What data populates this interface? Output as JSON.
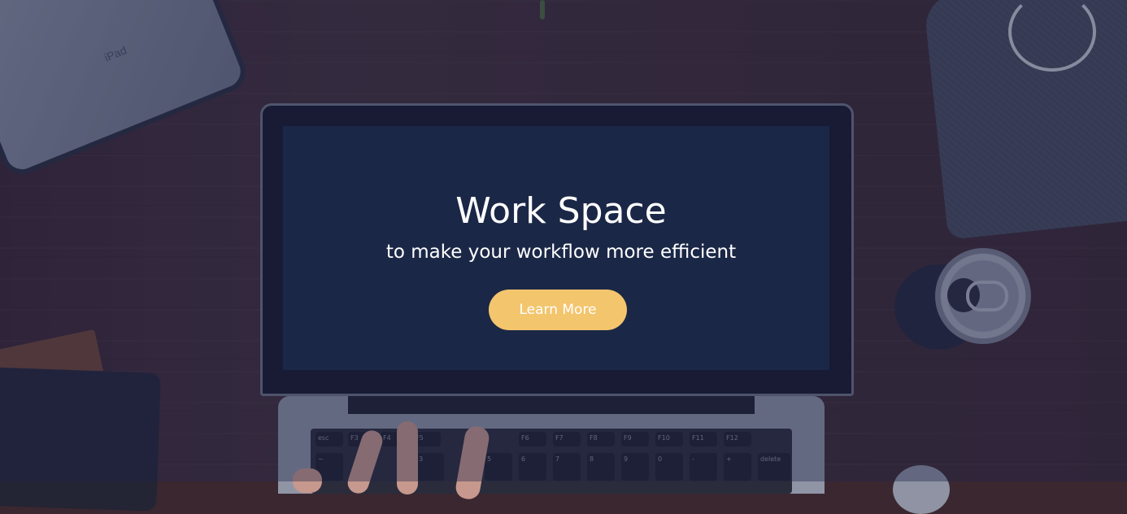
{
  "hero": {
    "title": "Work Space",
    "subtitle": "to make your workflow more efficient",
    "cta_label": "Learn More"
  },
  "colors": {
    "cta_background": "#f3c56d",
    "screen": "#1b2a46",
    "text": "#ffffff"
  },
  "background": {
    "tablet_label": "iPad",
    "keys": [
      "esc",
      "F3",
      "F4",
      "F5",
      "F6",
      "F7",
      "F8",
      "F9",
      "F10",
      "F11",
      "F12",
      "~",
      "3",
      "5",
      "6",
      "7",
      "8",
      "9",
      "0",
      "-",
      "+",
      "delete"
    ]
  }
}
